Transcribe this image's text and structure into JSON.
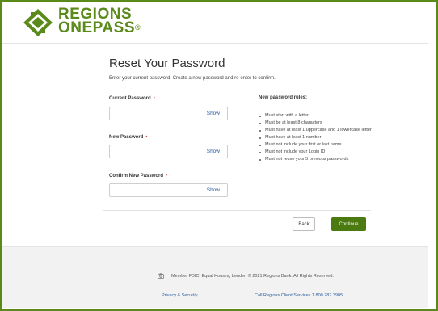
{
  "brand": {
    "line1": "REGIONS",
    "line2": "ONEPASS",
    "reg_mark": "®",
    "accent": "#5a8a1a"
  },
  "form": {
    "title": "Reset Your Password",
    "subtitle": "Enter your current password. Create a new password and re-enter to confirm.",
    "required_marker": "•",
    "fields": [
      {
        "label": "Current Password",
        "show_label": "Show",
        "value": ""
      },
      {
        "label": "New Password",
        "show_label": "Show",
        "value": ""
      },
      {
        "label": "Confirm New Password",
        "show_label": "Show",
        "value": ""
      }
    ]
  },
  "rules": {
    "title": "New password rules:",
    "items": [
      "Must start with a letter",
      "Must be at least 8 characters",
      "Must have at least 1 uppercase and 1 lowercase letter",
      "Must have at least 1 number",
      "Must not include your first or last name",
      "Must not include your Login ID",
      "Must not reuse your 5 previous passwords"
    ]
  },
  "actions": {
    "back_label": "Back",
    "continue_label": "Continue",
    "continue_color": "#4a7a10"
  },
  "footer": {
    "member_text": "Member FDIC. Equal Housing Lender. © 2021 Regions Bank. All Rights Reserved.",
    "privacy_link": "Privacy & Security",
    "client_services_link": "Call Regions Client Services 1 800 787 3905"
  }
}
